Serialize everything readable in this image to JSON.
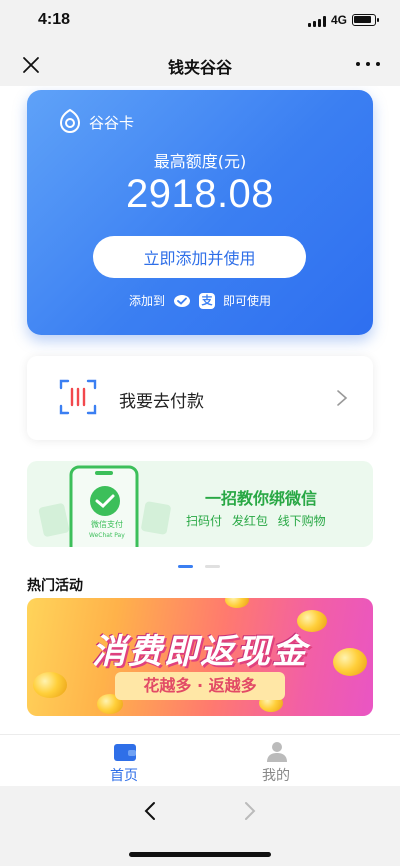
{
  "status_bar": {
    "time": "4:18",
    "network": "4G",
    "battery_level": 0.8
  },
  "nav": {
    "title": "钱夹谷谷",
    "close_icon": "close-icon",
    "more_icon": "more-icon"
  },
  "card": {
    "name": "谷谷卡",
    "limit_label": "最高额度(元)",
    "limit_value": "2918.08",
    "add_button": "立即添加并使用",
    "add_prefix": "添加到",
    "wechat_icon": "wechat-pay-icon",
    "alipay_icon": "alipay-icon",
    "alipay_glyph": "支",
    "add_suffix": "即可使用",
    "gradient_colors": [
      "#5fa2f8",
      "#2e6ff0"
    ]
  },
  "pay": {
    "label": "我要去付款",
    "icon": "scan-code-icon"
  },
  "wechat_banner": {
    "headline": "一招教你绑微信",
    "sub": "扫码付 发红包 线下购物",
    "phone_text": "微信支付",
    "phone_text_en": "WeChat Pay",
    "accent": "#29a845"
  },
  "carousel": {
    "current": 1,
    "total": 2
  },
  "section": {
    "title": "热门活动"
  },
  "promo": {
    "title": "消费即返现金",
    "sub": "花越多 · 返越多"
  },
  "tabs": [
    {
      "label": "首页",
      "icon": "wallet-icon",
      "active": true
    },
    {
      "label": "我的",
      "icon": "user-icon",
      "active": false
    }
  ],
  "browser": {
    "back_icon": "back-arrow-icon",
    "forward_icon": "forward-arrow-icon"
  }
}
